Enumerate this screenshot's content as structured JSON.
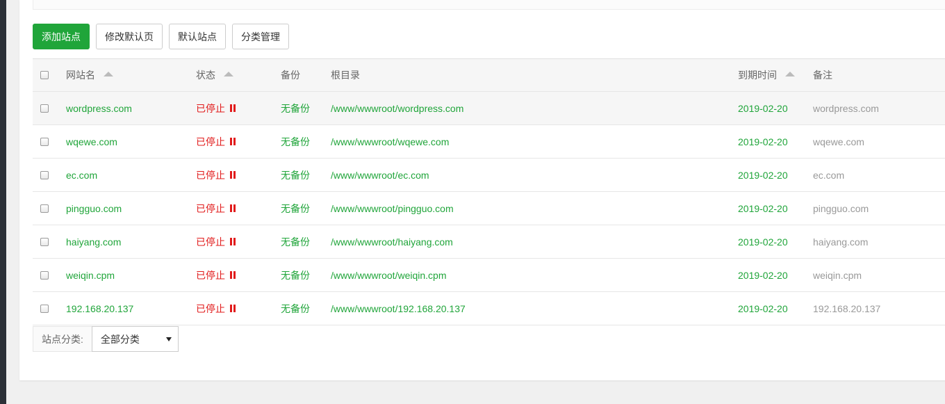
{
  "toolbar": {
    "add_site": "添加站点",
    "edit_default_page": "修改默认页",
    "default_site": "默认站点",
    "category_manage": "分类管理"
  },
  "table": {
    "headers": {
      "name": "网站名",
      "status": "状态",
      "backup": "备份",
      "root": "根目录",
      "expire": "到期时间",
      "note": "备注"
    },
    "rows": [
      {
        "name": "wordpress.com",
        "status": "已停止",
        "backup": "无备份",
        "root": "/www/wwwroot/wordpress.com",
        "expire": "2019-02-20",
        "note": "wordpress.com"
      },
      {
        "name": "wqewe.com",
        "status": "已停止",
        "backup": "无备份",
        "root": "/www/wwwroot/wqewe.com",
        "expire": "2019-02-20",
        "note": "wqewe.com"
      },
      {
        "name": "ec.com",
        "status": "已停止",
        "backup": "无备份",
        "root": "/www/wwwroot/ec.com",
        "expire": "2019-02-20",
        "note": "ec.com"
      },
      {
        "name": "pingguo.com",
        "status": "已停止",
        "backup": "无备份",
        "root": "/www/wwwroot/pingguo.com",
        "expire": "2019-02-20",
        "note": "pingguo.com"
      },
      {
        "name": "haiyang.com",
        "status": "已停止",
        "backup": "无备份",
        "root": "/www/wwwroot/haiyang.com",
        "expire": "2019-02-20",
        "note": "haiyang.com"
      },
      {
        "name": "weiqin.cpm",
        "status": "已停止",
        "backup": "无备份",
        "root": "/www/wwwroot/weiqin.cpm",
        "expire": "2019-02-20",
        "note": "weiqin.cpm"
      },
      {
        "name": "192.168.20.137",
        "status": "已停止",
        "backup": "无备份",
        "root": "/www/wwwroot/192.168.20.137",
        "expire": "2019-02-20",
        "note": "192.168.20.137"
      }
    ]
  },
  "footer": {
    "category_label": "站点分类:",
    "category_selected": "全部分类"
  },
  "colors": {
    "brand_green": "#20a53a",
    "stopped_red": "#e11b1b",
    "note_gray": "#999999"
  },
  "icons": {
    "status": "pause-icon",
    "sort": "sort-up-icon",
    "select": "caret-down-icon"
  }
}
